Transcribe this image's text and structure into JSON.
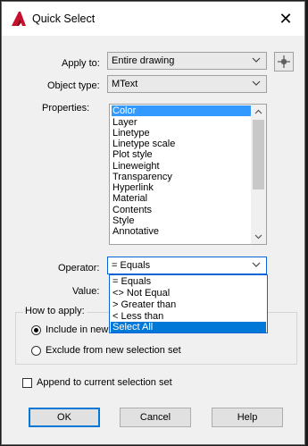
{
  "window": {
    "title": "Quick Select",
    "app_icon": "autocad-a-icon",
    "close_glyph": "✕"
  },
  "fields": {
    "apply_to": {
      "label": "Apply to:",
      "value": "Entire drawing"
    },
    "object_type": {
      "label": "Object type:",
      "value": "MText"
    },
    "properties": {
      "label": "Properties:",
      "items": [
        "Color",
        "Layer",
        "Linetype",
        "Linetype scale",
        "Plot style",
        "Lineweight",
        "Transparency",
        "Hyperlink",
        "Material",
        "Contents",
        "Style",
        "Annotative"
      ],
      "selected": "Color"
    },
    "operator": {
      "label": "Operator:",
      "value": "= Equals",
      "options": [
        "= Equals",
        "<> Not Equal",
        "> Greater than",
        "< Less than",
        "Select All"
      ],
      "highlighted": "Select All"
    },
    "value": {
      "label": "Value:"
    }
  },
  "how_to_apply": {
    "title": "How to apply:",
    "include_label": "Include in new selection set",
    "exclude_label": "Exclude from new selection set",
    "selected": "include"
  },
  "append": {
    "label": "Append to current selection set",
    "checked": false
  },
  "buttons": {
    "ok": "OK",
    "cancel": "Cancel",
    "help": "Help"
  },
  "colors": {
    "accent": "#0078d7",
    "selection": "#3399ff",
    "app_icon_red": "#c8102e"
  }
}
